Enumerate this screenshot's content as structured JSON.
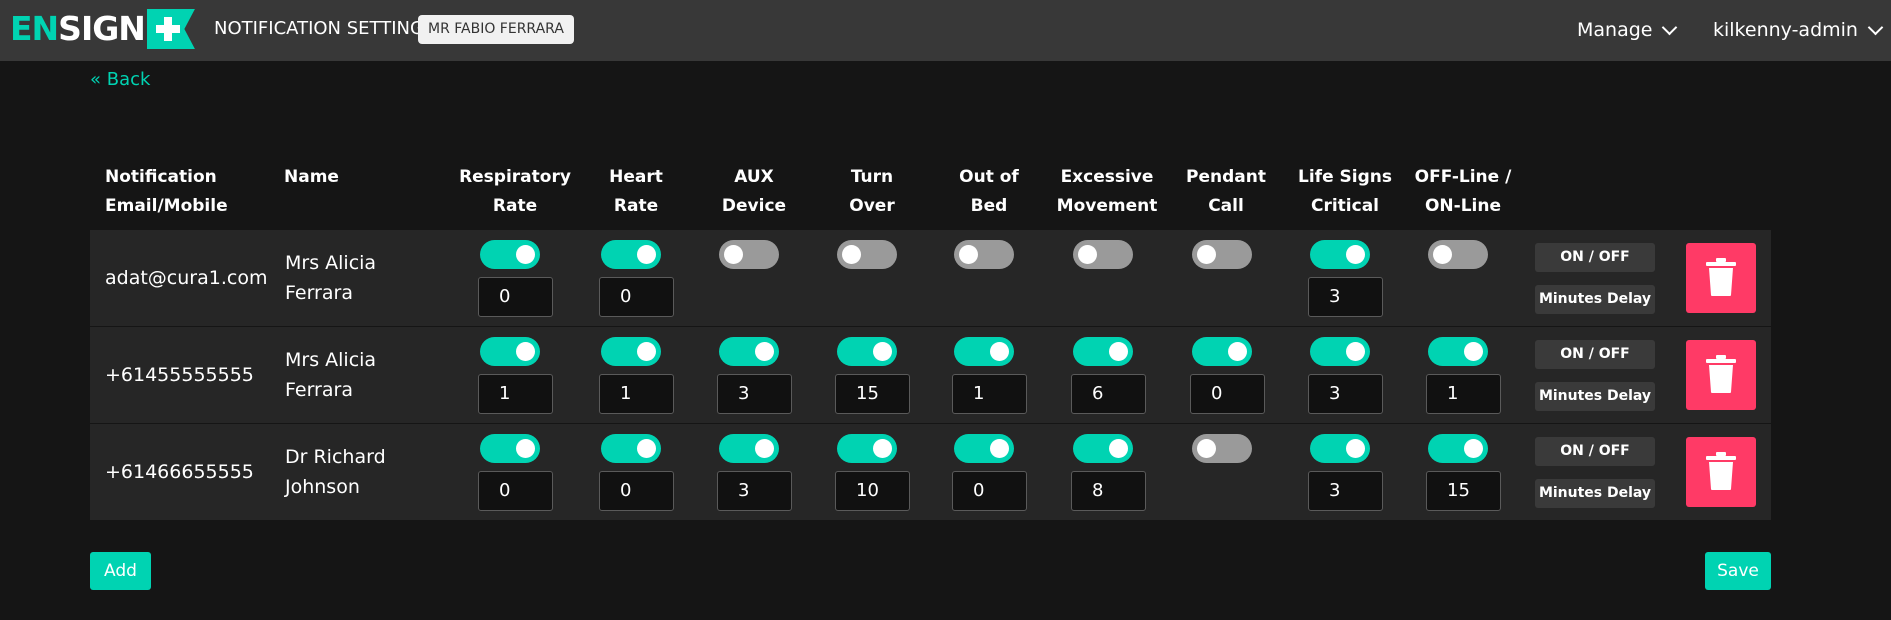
{
  "header": {
    "logo": "ENSIGN",
    "logo_prefix": "EN",
    "logo_suffix": "SIGN",
    "page_title": "NOTIFICATION SETTINGS",
    "patient_name": "MR FABIO FERRARA",
    "manage_label": "Manage",
    "user_label": "kilkenny-admin"
  },
  "back_label": "« Back",
  "columns": {
    "contact": [
      "Notification",
      "Email/Mobile"
    ],
    "name": [
      "Name"
    ],
    "respiratory": [
      "Respiratory",
      "Rate"
    ],
    "heart": [
      "Heart",
      "Rate"
    ],
    "aux": [
      "AUX",
      "Device"
    ],
    "turn": [
      "Turn",
      "Over"
    ],
    "bed": [
      "Out of",
      "Bed"
    ],
    "movement": [
      "Excessive",
      "Movement"
    ],
    "pendant": [
      "Pendant",
      "Call"
    ],
    "lifesigns": [
      "Life Signs",
      "Critical"
    ],
    "offline": [
      "OFF-Line /",
      "ON-Line"
    ]
  },
  "rows": [
    {
      "contact": "adat@cura1.com",
      "name": [
        "Mrs Alicia",
        "Ferrara"
      ],
      "respiratory": {
        "on": true,
        "delay": "0"
      },
      "heart": {
        "on": true,
        "delay": "0"
      },
      "aux": {
        "on": false
      },
      "turn": {
        "on": false
      },
      "bed": {
        "on": false
      },
      "movement": {
        "on": false
      },
      "pendant": {
        "on": false
      },
      "lifesigns": {
        "on": true,
        "delay": "3"
      },
      "offline": {
        "on": false
      }
    },
    {
      "contact": "+61455555555",
      "name": [
        "Mrs Alicia",
        "Ferrara"
      ],
      "respiratory": {
        "on": true,
        "delay": "1"
      },
      "heart": {
        "on": true,
        "delay": "1"
      },
      "aux": {
        "on": true,
        "delay": "3"
      },
      "turn": {
        "on": true,
        "delay": "15"
      },
      "bed": {
        "on": true,
        "delay": "1"
      },
      "movement": {
        "on": true,
        "delay": "6"
      },
      "pendant": {
        "on": true,
        "delay": "0"
      },
      "lifesigns": {
        "on": true,
        "delay": "3"
      },
      "offline": {
        "on": true,
        "delay": "1"
      }
    },
    {
      "contact": "+61466655555",
      "name": [
        "Dr Richard",
        "Johnson"
      ],
      "respiratory": {
        "on": true,
        "delay": "0"
      },
      "heart": {
        "on": true,
        "delay": "0"
      },
      "aux": {
        "on": true,
        "delay": "3"
      },
      "turn": {
        "on": true,
        "delay": "10"
      },
      "bed": {
        "on": true,
        "delay": "0"
      },
      "movement": {
        "on": true,
        "delay": "8"
      },
      "pendant": {
        "on": false
      },
      "lifesigns": {
        "on": true,
        "delay": "3"
      },
      "offline": {
        "on": true,
        "delay": "15"
      }
    }
  ],
  "row_buttons": {
    "on_off": "ON / OFF",
    "minutes_delay": "Minutes Delay",
    "delete_icon": "trash-icon"
  },
  "footer": {
    "add_label": "Add",
    "save_label": "Save"
  },
  "colors": {
    "accent": "#00d3b2",
    "delete": "#ff3a66",
    "toggle_off": "#9a9a9a",
    "background": "#151515",
    "topbar": "#383838"
  }
}
